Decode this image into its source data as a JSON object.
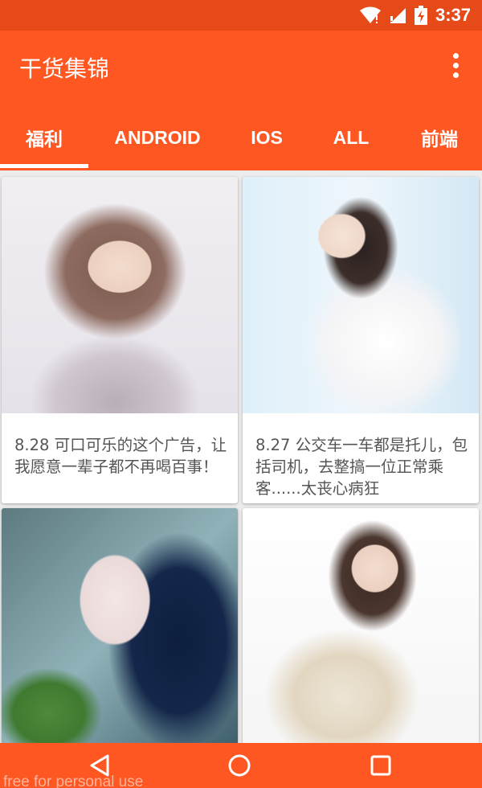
{
  "status_bar": {
    "time": "3:37",
    "icons": [
      "wifi-icon",
      "cellular-signal-icon",
      "battery-charging-icon"
    ]
  },
  "app_bar": {
    "title": "干货集锦",
    "menu_icon": "more-vert-icon"
  },
  "tabs": [
    {
      "label": "福利",
      "selected": true
    },
    {
      "label": "ANDROID",
      "selected": false
    },
    {
      "label": "IOS",
      "selected": false
    },
    {
      "label": "ALL",
      "selected": false
    },
    {
      "label": "前端",
      "selected": false
    }
  ],
  "cards": [
    {
      "caption": "8.28  可口可乐的这个广告，让我愿意一辈子都不再喝百事！"
    },
    {
      "caption": "8.27  公交车一车都是托儿，包括司机，去整搞一位正常乘客......太丧心病狂"
    },
    {
      "caption": ""
    },
    {
      "caption": ""
    }
  ],
  "nav_bar": {
    "icons": [
      "back-triangle-icon",
      "home-circle-icon",
      "recents-square-icon"
    ]
  },
  "watermark": "free for personal use",
  "colors": {
    "status_bar": "#e64a19",
    "primary": "#ff5722",
    "background": "#ececec",
    "caption_text": "#555555"
  }
}
